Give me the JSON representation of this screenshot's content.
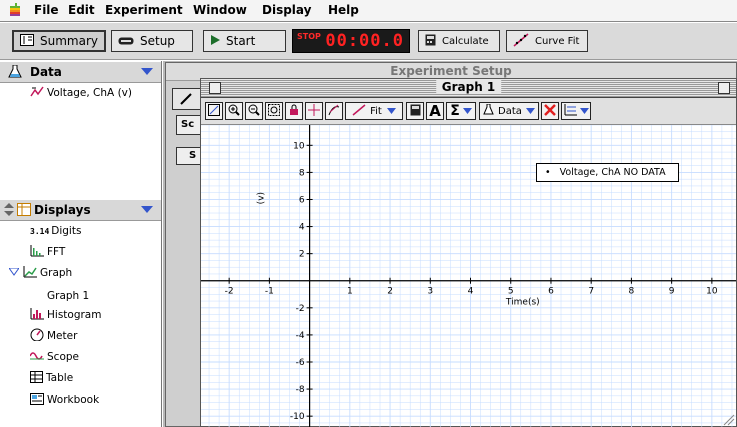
{
  "menubar": {
    "items": [
      "File",
      "Edit",
      "Experiment",
      "Window",
      "Display",
      "Help"
    ]
  },
  "toolbar": {
    "summary": "Summary",
    "setup": "Setup",
    "start": "Start",
    "stop_label": "STOP",
    "time": "00:00.0",
    "calculate": "Calculate",
    "curve_fit": "Curve Fit"
  },
  "data_panel": {
    "title": "Data",
    "items": [
      "Voltage, ChA (v)"
    ]
  },
  "displays_panel": {
    "title": "Displays",
    "items": [
      "Digits",
      "FFT",
      "Graph",
      "Graph 1",
      "Histogram",
      "Meter",
      "Scope",
      "Table",
      "Workbook"
    ],
    "digits_icon_text": "3.14"
  },
  "experiment_window": {
    "title": "Experiment Setup",
    "tab_sc": "Sc",
    "tab_s": "S"
  },
  "graph_window": {
    "title": "Graph 1",
    "tools": {
      "fit": "Fit",
      "data": "Data"
    },
    "legend": "Voltage, ChA NO DATA",
    "x_label": "Time(s)",
    "y_label": "(v)"
  },
  "colors": {
    "stop_red": "#ff2222",
    "grid": "#c6dcff",
    "accent_blue": "#3355cc"
  },
  "chart_data": {
    "type": "line",
    "series": [
      {
        "name": "Voltage, ChA",
        "values": []
      }
    ],
    "xlim": [
      -2.7,
      10.6
    ],
    "ylim": [
      -10.8,
      11.5
    ],
    "x_ticks": [
      -2,
      -1,
      1,
      2,
      3,
      4,
      5,
      6,
      7,
      8,
      9,
      10
    ],
    "y_ticks": [
      10,
      8,
      6,
      4,
      2,
      -2,
      -4,
      -6,
      -8,
      -10
    ],
    "xlabel": "Time(s)",
    "ylabel": "(v)",
    "grid": true,
    "legend_position": "top-right"
  }
}
